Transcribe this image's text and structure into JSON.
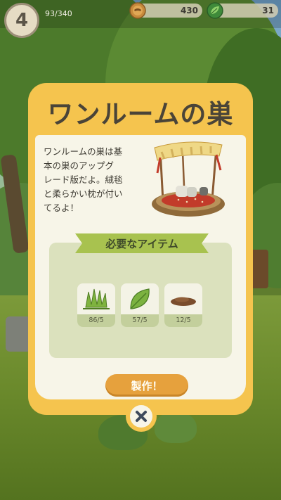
{
  "hud": {
    "level": "4",
    "xp": "93/340",
    "acorn_count": "430",
    "leaf_count": "31"
  },
  "dialog": {
    "title": "ワンルームの巣",
    "description_lines": [
      "ワンルームの巣は基",
      "本の巣のアップグ",
      "レード版だよ。絨毯",
      "と柔らかい枕が付い",
      "てるよ！"
    ],
    "required_header": "必要なアイテム",
    "items": [
      {
        "icon": "grass-icon",
        "count": "86/5"
      },
      {
        "icon": "leaf-icon",
        "count": "57/5"
      },
      {
        "icon": "mud-icon",
        "count": "12/5"
      }
    ],
    "craft_label": "製作！"
  },
  "colors": {
    "dialog_frame": "#f5c44e",
    "dialog_body": "#f7f5e8",
    "panel": "#dbe1bd",
    "ribbon": "#a8c24f",
    "button": "#e6a13d",
    "title_text": "#4a4438"
  }
}
